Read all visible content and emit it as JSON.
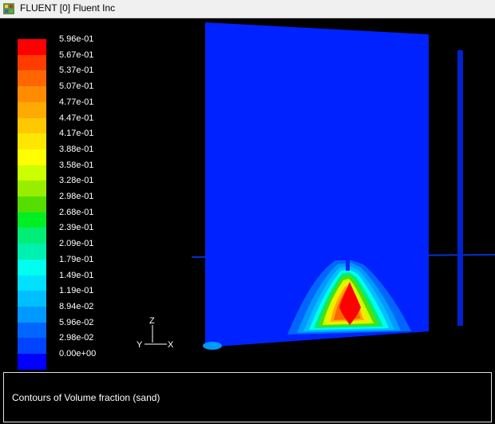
{
  "window": {
    "title": "FLUENT [0] Fluent Inc"
  },
  "colorbar": {
    "levels": [
      {
        "label": "5.96e-01",
        "color": "#ff0000"
      },
      {
        "label": "5.67e-01",
        "color": "#ff3c00"
      },
      {
        "label": "5.37e-01",
        "color": "#ff6600"
      },
      {
        "label": "5.07e-01",
        "color": "#ff8c00"
      },
      {
        "label": "4.77e-01",
        "color": "#ffaa00"
      },
      {
        "label": "4.47e-01",
        "color": "#ffc800"
      },
      {
        "label": "4.17e-01",
        "color": "#ffe600"
      },
      {
        "label": "3.88e-01",
        "color": "#ffff00"
      },
      {
        "label": "3.58e-01",
        "color": "#ccff00"
      },
      {
        "label": "3.28e-01",
        "color": "#99ee00"
      },
      {
        "label": "2.98e-01",
        "color": "#55dd00"
      },
      {
        "label": "2.68e-01",
        "color": "#00ee22"
      },
      {
        "label": "2.39e-01",
        "color": "#00ee77"
      },
      {
        "label": "2.09e-01",
        "color": "#00f0b0"
      },
      {
        "label": "1.79e-01",
        "color": "#00ffee"
      },
      {
        "label": "1.49e-01",
        "color": "#00e0ff"
      },
      {
        "label": "1.19e-01",
        "color": "#00bfff"
      },
      {
        "label": "8.94e-02",
        "color": "#0099ff"
      },
      {
        "label": "5.96e-02",
        "color": "#0066ff"
      },
      {
        "label": "2.98e-02",
        "color": "#0044ff"
      },
      {
        "label": "0.00e+00",
        "color": "#0000ff"
      }
    ]
  },
  "axes": {
    "z": "Z",
    "y": "Y",
    "x": "X"
  },
  "caption": "Contours of Volume fraction (sand)"
}
